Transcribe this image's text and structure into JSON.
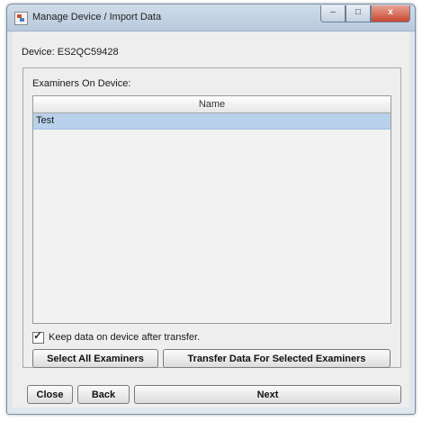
{
  "window": {
    "title": "Manage Device / Import Data",
    "caption_buttons": {
      "minimize": "–",
      "maximize": "□",
      "close": "x"
    }
  },
  "device": {
    "line": "Device: ES2QC59428"
  },
  "examiners": {
    "heading": "Examiners On Device:",
    "table": {
      "columns": [
        "Name"
      ],
      "rows": [
        {
          "name": "Test",
          "selected": true
        }
      ]
    }
  },
  "keep_data": {
    "label": "Keep data on device after transfer.",
    "checked": true
  },
  "buttons": {
    "select_all": "Select All Examiners",
    "transfer": "Transfer Data For Selected Examiners",
    "close": "Close",
    "back": "Back",
    "next": "Next"
  }
}
